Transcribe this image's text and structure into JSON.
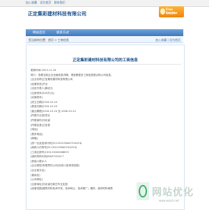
{
  "topbar": {
    "links": [
      "加入收藏",
      "设为首页",
      "联系我们"
    ]
  },
  "header": {
    "site_title": "正定集彩建材科技有限公司",
    "badge_line1": "Free Service",
    "badge_line2": "在线咨询"
  },
  "nav": {
    "items": [
      "网站首页",
      "联系方式"
    ]
  },
  "breadcrumb": {
    "left": "您当前的位置：首页 > 工商信息",
    "right": "加入收藏 | 设为首页"
  },
  "card": {
    "title": "正定集彩建材科技有限公司的工商信息",
    "rows": [
      "更新时间:2023-11-18",
      "简介：查看当前企业全面信息详情，请查看更多工商信息登记和公司信息。",
      "[企业名称]正定集彩建材科技有限公司",
      "[经营状态]开业",
      "[法定代表人]郭纪元",
      "[注册资本]300万(元)",
      "[实缴资本]",
      "[成立日期]2016-10-24",
      "[核准日期]2016-10-24",
      "[营业期限]2016-10-24 至 2046-10-23",
      "[所属行业]批发业",
      "[所属省份]河北省",
      "[所属区县]正定县",
      "[电话]",
      "[更多电话]",
      "[邮箱]",
      "[统一社会信用代码]91130123MA07UG4Y4J",
      "[纳税人识别号]91130123MA07UG4Y4J",
      "[工商注册号]130123000068872",
      "[组织机构代码]MA07UG4Y-7",
      "[参保人数]0人",
      "[企业类型]有限责任公司(自然人投资或控股)",
      "[企业英文名]",
      "[曾用名]",
      "[公司网址]",
      "[注册地址]河北省石家庄市正定县",
      "[经营范围]建筑材料技术开发、技术转让、技术推广；建材、装饰材料销售"
    ]
  },
  "watermark": {
    "big": "网站优化",
    "small": "www.wzyh.net"
  }
}
